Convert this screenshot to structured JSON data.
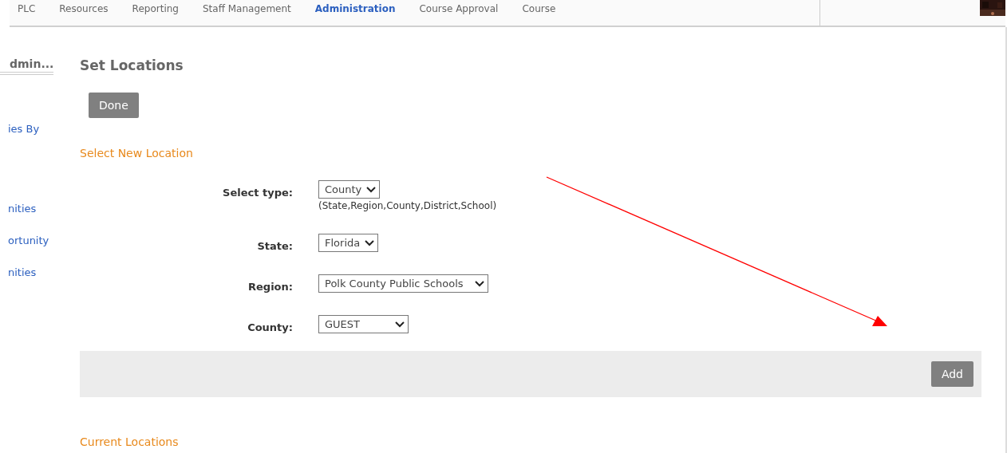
{
  "nav": {
    "items": [
      {
        "label": "PLC",
        "selected": false
      },
      {
        "label": "Resources",
        "selected": false
      },
      {
        "label": "Reporting",
        "selected": false
      },
      {
        "label": "Staff Management",
        "selected": false
      },
      {
        "label": "Administration",
        "selected": true
      },
      {
        "label": "Course Approval",
        "selected": false
      },
      {
        "label": "Course",
        "selected": false
      }
    ]
  },
  "sidebar": {
    "title": "dmin...",
    "links": [
      "ies By",
      "nities",
      "ortunity",
      "nities"
    ]
  },
  "page": {
    "title": "Set Locations",
    "done_button": "Done",
    "section_title": "Select New Location",
    "fields": [
      {
        "label": "Select type:",
        "value": "County",
        "hint": "(State,Region,County,District,School)"
      },
      {
        "label": "State:",
        "value": "Florida"
      },
      {
        "label": "Region:",
        "value": "Polk County Public Schools"
      },
      {
        "label": "County:",
        "value": "GUEST"
      }
    ],
    "add_button": "Add",
    "current_title": "Current Locations"
  },
  "annotation": {
    "kind": "arrow",
    "color": "#ff0000"
  }
}
